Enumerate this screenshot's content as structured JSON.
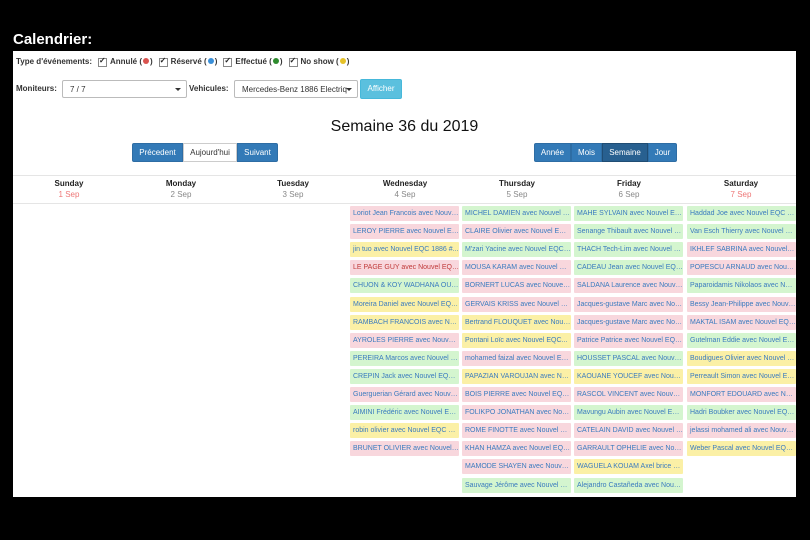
{
  "page": {
    "heading": "Calendrier:"
  },
  "filters": {
    "label": "Type d'événements:",
    "types": [
      {
        "label": "Annulé (",
        "suffix": ")",
        "color": "#d9534f"
      },
      {
        "label": "Réservé (",
        "suffix": ")",
        "color": "#3a8fd8"
      },
      {
        "label": "Effectué (",
        "suffix": ")",
        "color": "#2e8b2e"
      },
      {
        "label": "No show (",
        "suffix": ")",
        "color": "#e6c229"
      }
    ]
  },
  "moniteurs": {
    "label": "Moniteurs:",
    "value": "7 / 7"
  },
  "vehicules": {
    "label": "Vehicules:",
    "value": "Mercedes-Benz 1886 Electriq"
  },
  "afficher_label": "Afficher",
  "week_title": "Semaine 36 du 2019",
  "nav": {
    "prev": "Précedent",
    "today": "Aujourd'hui",
    "next": "Suivant"
  },
  "views": [
    "Année",
    "Mois",
    "Semaine",
    "Jour"
  ],
  "active_view": "Semaine",
  "days": [
    {
      "name": "Sunday",
      "date": "1 Sep",
      "today": true
    },
    {
      "name": "Monday",
      "date": "2 Sep",
      "today": false
    },
    {
      "name": "Tuesday",
      "date": "3 Sep",
      "today": false
    },
    {
      "name": "Wednesday",
      "date": "4 Sep",
      "today": false
    },
    {
      "name": "Thursday",
      "date": "5 Sep",
      "today": false
    },
    {
      "name": "Friday",
      "date": "6 Sep",
      "today": false
    },
    {
      "name": "Saturday",
      "date": "7 Sep",
      "today": true
    }
  ],
  "events": {
    "wednesday": [
      {
        "text": "Loriot Jean Francois avec Nouvel EQC 1886 #...",
        "color": "pink"
      },
      {
        "text": "LEROY PIERRE avec Nouvel EQC 1886 #...",
        "color": "pink"
      },
      {
        "text": "jin tuo avec Nouvel EQC 1886 #...",
        "color": "yellow"
      },
      {
        "text": "LE PAGE GUY avec Nouvel EQC 1886 #...",
        "color": "pink",
        "tc": "redt"
      },
      {
        "text": "CHUON & KOY WADHANA OU ...",
        "color": "green"
      },
      {
        "text": "Moreira Daniel avec Nouvel EQC 1886 #...",
        "color": "yellow"
      },
      {
        "text": "RAMBACH FRANCOIS avec Nouvel EQC...",
        "color": "yellow"
      },
      {
        "text": "AYROLES PIERRE avec Nouvel EQC...",
        "color": "pink"
      },
      {
        "text": "PEREIRA Marcos avec Nouvel EQC...",
        "color": "green"
      },
      {
        "text": "CREPIN Jack avec Nouvel EQC...",
        "color": "green"
      },
      {
        "text": "Guerguerian Gérard avec Nouvel EQC...",
        "color": "pink"
      },
      {
        "text": "AIMINI Frédéric avec Nouvel EQC...",
        "color": "green"
      },
      {
        "text": "robin olivier avec Nouvel EQC 1886...",
        "color": "yellow"
      },
      {
        "text": "BRUNET OLIVIER avec Nouvel EQC...",
        "color": "pink"
      }
    ],
    "thursday": [
      {
        "text": "MICHEL DAMIEN avec Nouvel EQC...",
        "color": "green"
      },
      {
        "text": "CLAIRE Olivier avec Nouvel EQC...",
        "color": "pink"
      },
      {
        "text": "M'zari Yacine avec Nouvel EQC 1886...",
        "color": "green"
      },
      {
        "text": "MOUSA KARAM avec Nouvel EQC...",
        "color": "pink"
      },
      {
        "text": "BORNERT LUCAS avec Nouvel EQC...",
        "color": "pink"
      },
      {
        "text": "GERVAIS KRISS avec Nouvel EQC...",
        "color": "pink"
      },
      {
        "text": "Bertrand FLOUQUET avec Nouvel EQC...",
        "color": "yellow"
      },
      {
        "text": "Pontani Loïc avec Nouvel EQC...",
        "color": "yellow"
      },
      {
        "text": "mohamed faizal avec Nouvel EQC...",
        "color": "pink"
      },
      {
        "text": "PAPAZIAN VAROUJAN avec Nouvel EQC...",
        "color": "yellow"
      },
      {
        "text": "BOIS PIERRE avec Nouvel EQC...",
        "color": "pink"
      },
      {
        "text": "FOLIKPO JONATHAN avec Nouvel EQC...",
        "color": "pink"
      },
      {
        "text": "ROME FINOTTE avec Nouvel EQC...",
        "color": "pink"
      },
      {
        "text": "KHAN HAMZA avec Nouvel EQC...",
        "color": "pink"
      },
      {
        "text": "MAMODE SHAYEN avec Nouvel EQC...",
        "color": "pink"
      },
      {
        "text": "Sauvage Jérôme avec Nouvel EQC...",
        "color": "green"
      }
    ],
    "friday": [
      {
        "text": "MAHE SYLVAIN avec Nouvel EQC...",
        "color": "green"
      },
      {
        "text": "Senange Thibault avec Nouvel EQC...",
        "color": "green"
      },
      {
        "text": "THACH Tech-Lim avec Nouvel EQC...",
        "color": "green"
      },
      {
        "text": "CADEAU Jean avec Nouvel EQC...",
        "color": "green"
      },
      {
        "text": "SALDANA Laurence avec Nouvel EQC...",
        "color": "pink"
      },
      {
        "text": "Jacques-gustave Marc avec Nouvel EQC...",
        "color": "pink"
      },
      {
        "text": "Jacques-gustave Marc avec Nouvel EQC...",
        "color": "pink"
      },
      {
        "text": "Patrice Patrice avec Nouvel EQC...",
        "color": "pink"
      },
      {
        "text": "HOUSSET PASCAL avec Nouvel EQC...",
        "color": "green"
      },
      {
        "text": "KAOUANE YOUCEF avec Nouvel EQC...",
        "color": "yellow"
      },
      {
        "text": "RASCOL VINCENT avec Nouvel EQC...",
        "color": "pink"
      },
      {
        "text": "Mavungu Aubin avec Nouvel EQC...",
        "color": "green"
      },
      {
        "text": "CATELAIN DAVID avec Nouvel EQC...",
        "color": "pink"
      },
      {
        "text": "GARRAULT OPHELIE avec Nouvel EQC...",
        "color": "pink"
      },
      {
        "text": "WAGUELA KOUAM Axel brice avec...",
        "color": "yellow"
      },
      {
        "text": "Alejandro Castañeda avec Nouvel EQC...",
        "color": "green"
      }
    ],
    "saturday": [
      {
        "text": "Haddad Joe avec Nouvel EQC 1886...",
        "color": "green"
      },
      {
        "text": "Van Esch Thierry avec Nouvel EQC...",
        "color": "green"
      },
      {
        "text": "IKHLEF SABRINA avec Nouvel EQC...",
        "color": "pink"
      },
      {
        "text": "POPESCU ARNAUD avec Nouvel EQC...",
        "color": "pink"
      },
      {
        "text": "Paparoidamis Nikolaos avec Nouvel EQC...",
        "color": "green"
      },
      {
        "text": "Bessy Jean-Philippe avec Nouvel EQC...",
        "color": "pink"
      },
      {
        "text": "MAKTAL ISAM avec Nouvel EQC...",
        "color": "pink"
      },
      {
        "text": "Gutelman Eddie avec Nouvel EQC...",
        "color": "green"
      },
      {
        "text": "Boudigues Olivier avec Nouvel EQC...",
        "color": "yellow"
      },
      {
        "text": "Perreault Simon avec Nouvel EQC...",
        "color": "yellow"
      },
      {
        "text": "MONFORT EDOUARD avec Nouvel EQC...",
        "color": "pink"
      },
      {
        "text": "Hadri Boubker avec Nouvel EQC...",
        "color": "green"
      },
      {
        "text": "jelassi mohamed ali avec Nouvel EQC...",
        "color": "pink"
      },
      {
        "text": "Weber Pascal avec Nouvel EQC...",
        "color": "yellow"
      }
    ]
  },
  "colors": {
    "pink": "#f8d7dd",
    "green": "#d4f5cf",
    "yellow": "#fbf0a6",
    "primary": "#337ab7",
    "info": "#5bc0de"
  }
}
